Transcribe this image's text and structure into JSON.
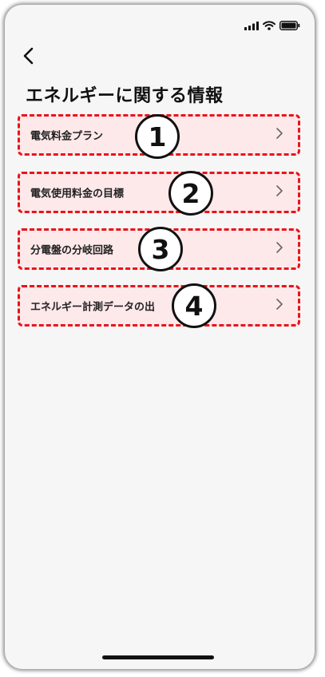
{
  "title": "エネルギーに関する情報",
  "menu_items": [
    {
      "label": "電気料金プラン",
      "badge": "1"
    },
    {
      "label": "電気使用料金の目標",
      "badge": "2"
    },
    {
      "label": "分電盤の分岐回路",
      "badge": "3"
    },
    {
      "label": "エネルギー計測データの出",
      "badge": "4"
    }
  ],
  "colors": {
    "highlight_border": "#e8141b",
    "highlight_fill": "#fde8ea",
    "background": "#f6f6f6",
    "text": "#111111"
  },
  "icons": [
    "signal-icon",
    "wifi-icon",
    "battery-icon",
    "back-arrow-icon",
    "chevron-right-icon"
  ]
}
